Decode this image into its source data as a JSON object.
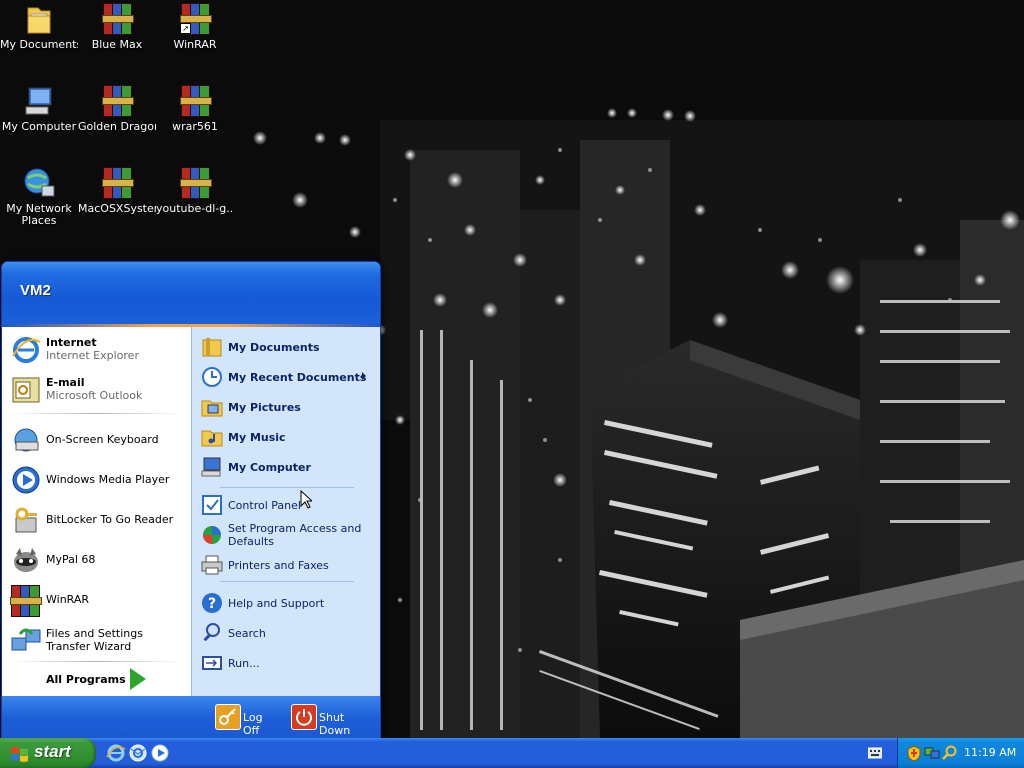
{
  "desktop": {
    "icons": [
      {
        "label": "My Documents"
      },
      {
        "label": "Blue Max"
      },
      {
        "label": "WinRAR"
      },
      {
        "label": "My Computer"
      },
      {
        "label": "Golden Dragon"
      },
      {
        "label": "wrar561"
      },
      {
        "label": "My Network Places"
      },
      {
        "label": "MacOSXSystem"
      },
      {
        "label": "youtube-dl-g..."
      }
    ]
  },
  "start_menu": {
    "user_name": "VM2",
    "pinned": [
      {
        "title": "Internet",
        "subtitle": "Internet Explorer"
      },
      {
        "title": "E-mail",
        "subtitle": "Microsoft Outlook"
      }
    ],
    "recent_programs": [
      {
        "label": "On-Screen Keyboard"
      },
      {
        "label": "Windows Media Player"
      },
      {
        "label": "BitLocker To Go Reader"
      },
      {
        "label": "MyPal 68"
      },
      {
        "label": "WinRAR"
      },
      {
        "label": "Files and Settings Transfer Wizard"
      }
    ],
    "all_programs_label": "All Programs",
    "places": [
      {
        "label": "My Documents"
      },
      {
        "label": "My Recent Documents"
      },
      {
        "label": "My Pictures"
      },
      {
        "label": "My Music"
      },
      {
        "label": "My Computer"
      }
    ],
    "settings": [
      {
        "label": "Control Panel"
      },
      {
        "label": "Set Program Access and Defaults"
      },
      {
        "label": "Printers and Faxes"
      }
    ],
    "help": [
      {
        "label": "Help and Support"
      },
      {
        "label": "Search"
      },
      {
        "label": "Run..."
      }
    ],
    "footer": {
      "log_off_label": "Log Off",
      "shut_down_label": "Shut Down"
    }
  },
  "taskbar": {
    "start_label": "start",
    "clock": "11:19 AM",
    "quick_launch": [
      "internet-explorer-icon",
      "outlook-express-icon",
      "windows-media-player-icon"
    ],
    "tray_icons": [
      "security-center-icon",
      "network-icon",
      "search-tray-icon"
    ]
  },
  "colors": {
    "taskbar_blue": "#245edb",
    "start_green": "#3c9a3c",
    "menu_right_panel": "#d3e5fa",
    "tray_blue": "#0c7fd8"
  }
}
